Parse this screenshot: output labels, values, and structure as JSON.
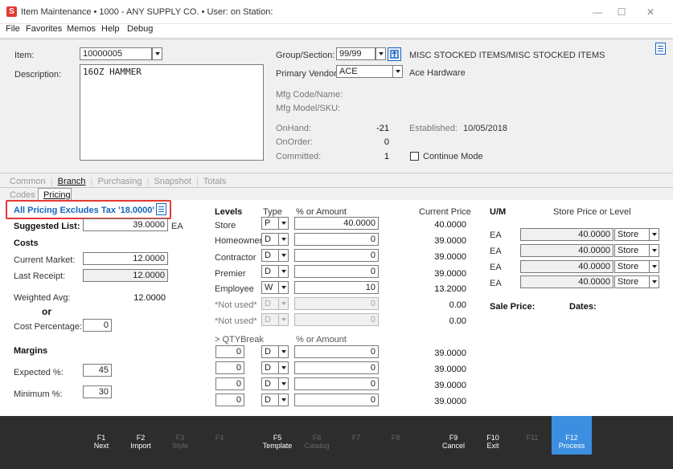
{
  "window": {
    "title": "Item Maintenance  •  1000 - ANY SUPPLY CO.  •  User:            on Station:",
    "minimize": "—",
    "maximize": "☐",
    "close": "✕"
  },
  "menu": [
    "File",
    "Favorites",
    "Memos",
    "Help",
    "Debug"
  ],
  "header": {
    "item_label": "Item:",
    "item_value": "10000005",
    "description_label": "Description:",
    "description_value": "16OZ HAMMER",
    "group_label": "Group/Section:",
    "group_value": "99/99",
    "group_name": "MISC STOCKED ITEMS/MISC STOCKED ITEMS",
    "vendor_label": "Primary Vendor:",
    "vendor_value": "ACE",
    "vendor_name": "Ace Hardware",
    "mfg_code_label": "Mfg Code/Name:",
    "mfg_model_label": "Mfg Model/SKU:",
    "onhand_label": "OnHand:",
    "onhand_value": "-21",
    "onorder_label": "OnOrder:",
    "onorder_value": "0",
    "committed_label": "Committed:",
    "committed_value": "1",
    "established_label": "Established:",
    "established_value": "10/05/2018",
    "continue_label": "Continue Mode"
  },
  "tabs_main": [
    "Common",
    "Branch",
    "Purchasing",
    "Snapshot",
    "Totals"
  ],
  "tabs_sub": [
    "Codes",
    "Pricing"
  ],
  "pricing": {
    "tax_banner": "All Pricing Excludes Tax  '18.0000'  %",
    "suggested_label": "Suggested List:",
    "suggested_value": "39.0000",
    "suggested_unit": "EA",
    "costs_label": "Costs",
    "current_market_label": "Current Market:",
    "current_market_value": "12.0000",
    "last_receipt_label": "Last Receipt:",
    "last_receipt_value": "12.0000",
    "weighted_label": "Weighted Avg:",
    "weighted_value": "12.0000",
    "or_label": "or",
    "cost_pct_label": "Cost Percentage:",
    "cost_pct_value": "0",
    "margins_label": "Margins",
    "expected_label": "Expected %:",
    "expected_value": "45",
    "minimum_label": "Minimum %:",
    "minimum_value": "30"
  },
  "levels": {
    "header_levels": "Levels",
    "header_type": "Type",
    "header_amount": "% or Amount",
    "header_current": "Current Price",
    "rows": [
      {
        "name": "Store",
        "type": "P",
        "amount": "40.0000",
        "current": "40.0000"
      },
      {
        "name": "Homeowner",
        "type": "D",
        "amount": "0",
        "current": "39.0000"
      },
      {
        "name": "Contractor",
        "type": "D",
        "amount": "0",
        "current": "39.0000"
      },
      {
        "name": "Premier",
        "type": "D",
        "amount": "0",
        "current": "39.0000"
      },
      {
        "name": "Employee",
        "type": "W",
        "amount": "10",
        "current": "13.2000"
      },
      {
        "name": "*Not used*",
        "type": "D",
        "amount": "0",
        "current": "0.00"
      },
      {
        "name": "*Not used*",
        "type": "D",
        "amount": "0",
        "current": "0.00"
      }
    ],
    "qty_header": "> QTYBreak",
    "qty_amount_header": "% or Amount",
    "qty_rows": [
      {
        "qty": "0",
        "type": "D",
        "amount": "0",
        "current": "39.0000"
      },
      {
        "qty": "0",
        "type": "D",
        "amount": "0",
        "current": "39.0000"
      },
      {
        "qty": "0",
        "type": "D",
        "amount": "0",
        "current": "39.0000"
      },
      {
        "qty": "0",
        "type": "D",
        "amount": "0",
        "current": "39.0000"
      }
    ]
  },
  "um": {
    "header_um": "U/M",
    "header_store": "Store Price or Level",
    "rows": [
      {
        "unit": "EA",
        "price": "40.0000",
        "level": "Store"
      },
      {
        "unit": "EA",
        "price": "40.0000",
        "level": "Store"
      },
      {
        "unit": "EA",
        "price": "40.0000",
        "level": "Store"
      },
      {
        "unit": "EA",
        "price": "40.0000",
        "level": "Store"
      }
    ],
    "sale_label": "Sale Price:",
    "dates_label": "Dates:"
  },
  "fkeys": [
    {
      "key": "F1",
      "label": "Next"
    },
    {
      "key": "F2",
      "label": "Import"
    },
    {
      "key": "F3",
      "label": "Style"
    },
    {
      "key": "F4",
      "label": ""
    },
    {
      "key": "F5",
      "label": "Template"
    },
    {
      "key": "F6",
      "label": "Catalog"
    },
    {
      "key": "F7",
      "label": ""
    },
    {
      "key": "F8",
      "label": ""
    },
    {
      "key": "F9",
      "label": "Cancel"
    },
    {
      "key": "F10",
      "label": "Exit"
    },
    {
      "key": "F11",
      "label": ""
    },
    {
      "key": "F12",
      "label": "Process"
    }
  ],
  "colors": {
    "accent": "#3b8ee0",
    "banner_text": "#1565c0",
    "highlight_border": "#e53935"
  }
}
